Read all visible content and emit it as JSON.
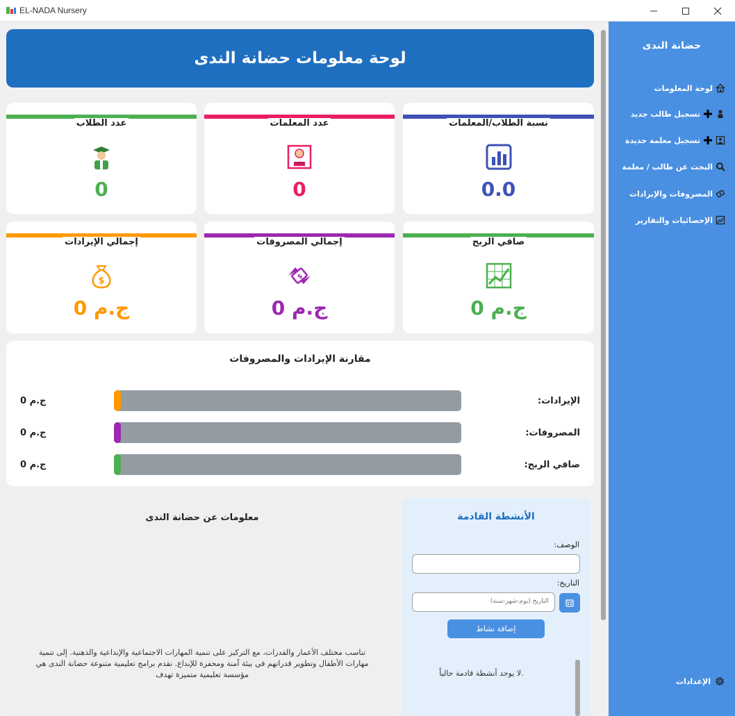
{
  "window": {
    "title": "EL-NADA Nursery"
  },
  "header": {
    "title": "لوحة معلومات حضانة الندى"
  },
  "stats": [
    {
      "title": "عدد الطلاب",
      "value": "0",
      "color": "#4caf50",
      "icon": "student-icon"
    },
    {
      "title": "عدد المعلمات",
      "value": "0",
      "color": "#e91e63",
      "icon": "teacher-icon"
    },
    {
      "title": "نسبة الطلاب/المعلمات",
      "value": "0.0",
      "color": "#3f51b5",
      "icon": "bar-chart-icon"
    },
    {
      "title": "إجمالي الإيرادات",
      "value": "0 ج.م",
      "color": "#ff9800",
      "icon": "money-bag-icon"
    },
    {
      "title": "إجمالي المصروفات",
      "value": "0 ج.م",
      "color": "#9c27b0",
      "icon": "money-wings-icon"
    },
    {
      "title": "صافي الربح",
      "value": "0 ج.م",
      "color": "#4caf50",
      "icon": "growth-chart-icon"
    }
  ],
  "comparison": {
    "title": "مقارنة الإيرادات والمصروفات",
    "rows": [
      {
        "label": "الإيرادات:",
        "value": "0 ج.م",
        "fraction": 0,
        "color": "#ff9800"
      },
      {
        "label": "المصروفات:",
        "value": "0 ج.م",
        "fraction": 0,
        "color": "#9c27b0"
      },
      {
        "label": "صافي الربح:",
        "value": "0 ج.م",
        "fraction": 0,
        "color": "#4caf50"
      }
    ]
  },
  "info": {
    "title": "معلومات عن حضانة الندى",
    "text": "تناسب مختلف الأعمار والقدرات، مع التركيز على تنمية المهارات الاجتماعية والإبداعية والذهنية. إلى تنمية مهارات الأطفال وتطوير قدراتهم في بيئة آمنة ومحفزة للإبداع. نقدم برامج تعليمية متنوعة حضانة الندى هي مؤسسة تعليمية متميزة تهدف"
  },
  "activities": {
    "title": "الأنشطة القادمة",
    "desc_label": "الوصف:",
    "desc_value": "",
    "date_label": "التاريخ:",
    "date_placeholder": "التاريخ (يوم-شهر-سنة)",
    "add_button": "إضافة نشاط",
    "empty_message": "لا يوجد أنشطة قادمة حالياً."
  },
  "sidebar": {
    "title": "حضانة الندى",
    "items": [
      {
        "label": "لوحة المعلومات",
        "icon": "house-icon"
      },
      {
        "label": "تسجيل طالب جديد",
        "icon": "plus-icon"
      },
      {
        "label": "تسجيل معلمة جديدة",
        "icon": "plus-icon"
      },
      {
        "label": "البحث عن طالب / معلمة",
        "icon": "magnifier-icon"
      },
      {
        "label": "المصروفات والإيرادات",
        "icon": "money-icon"
      },
      {
        "label": "الإحصائيات والتقارير",
        "icon": "chart-icon"
      }
    ],
    "settings_label": "الإعدادات"
  }
}
